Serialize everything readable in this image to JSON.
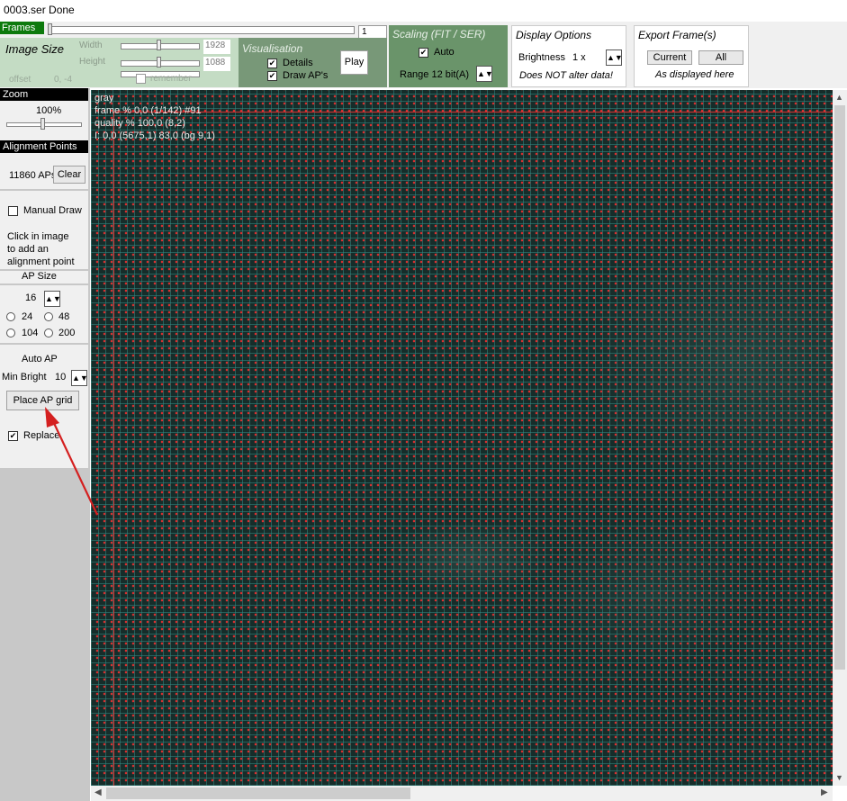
{
  "window": {
    "title": "0003.ser  Done"
  },
  "frames": {
    "tab_label": "Frames",
    "frame_number": "1"
  },
  "image_size": {
    "title": "Image Size",
    "width_label": "Width",
    "width_value": "1928",
    "height_label": "Height",
    "height_value": "1088",
    "offset_label": "offset",
    "offset_value": "0, -4",
    "remember_label": "remember"
  },
  "visualisation": {
    "title": "Visualisation",
    "details_label": "Details",
    "details_checked": true,
    "draw_aps_label": "Draw AP's",
    "draw_aps_checked": true,
    "play_label": "Play"
  },
  "scaling": {
    "title": "Scaling (FIT / SER)",
    "auto_label": "Auto",
    "auto_checked": true,
    "range_label": "Range 12 bit(A)"
  },
  "display_options": {
    "title": "Display Options",
    "brightness_label": "Brightness",
    "brightness_value": "1 x",
    "note": "Does NOT alter data!"
  },
  "export": {
    "title": "Export Frame(s)",
    "current_label": "Current",
    "all_label": "All",
    "note": "As displayed here"
  },
  "zoom": {
    "header": "Zoom",
    "value": "100%"
  },
  "alignment_points": {
    "header": "Alignment Points",
    "count": "11860 APs",
    "clear_label": "Clear",
    "manual_draw_label": "Manual Draw",
    "hint": [
      "Click in image",
      "to add an",
      "alignment point"
    ],
    "ap_size_label": "AP Size",
    "ap_size_value": "16",
    "sizes": [
      "24",
      "48",
      "104",
      "200"
    ],
    "auto_ap_label": "Auto AP",
    "min_bright_label": "Min Bright",
    "min_bright_value": "10",
    "place_grid_label": "Place AP grid",
    "replace_label": "Replace",
    "replace_checked": true
  },
  "overlay": {
    "line1": "gray",
    "line2": "frame % 0,0 (1/142) #91",
    "line3": "quality % 100,0  (8,2)",
    "line4": "I: 0,0 (5675,1) 83,0 (bg 9,1)"
  },
  "colors": {
    "frames_tab": "#0d7a0d",
    "grid": "#348a84",
    "ap_dot": "#d83030",
    "arrow": "#d42020"
  }
}
